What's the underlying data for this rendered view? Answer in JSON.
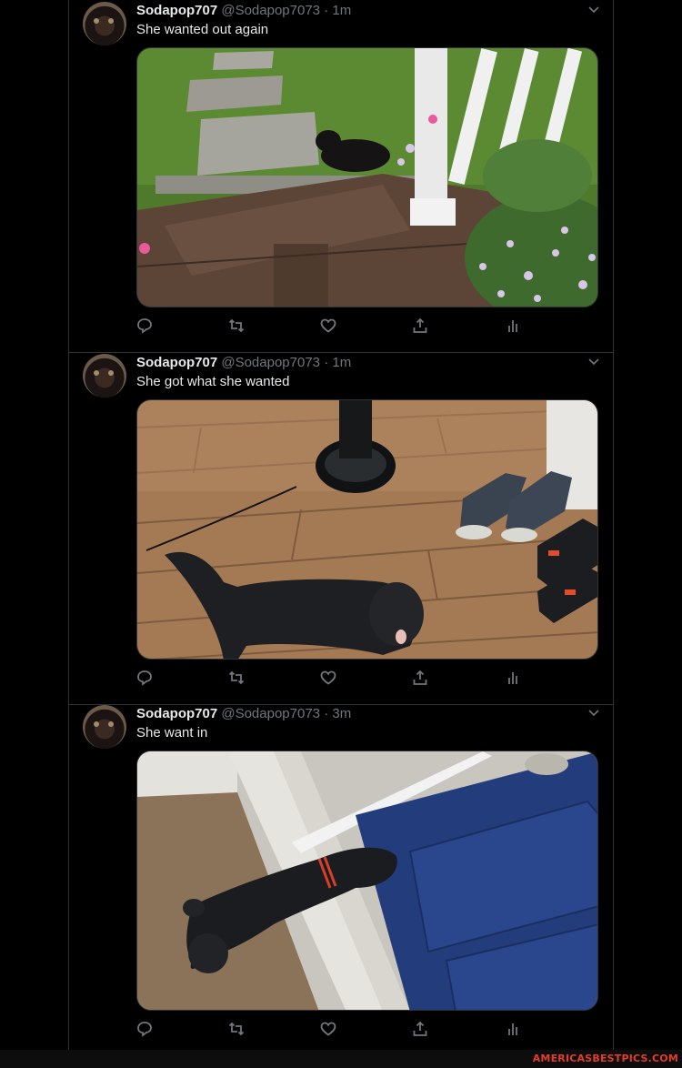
{
  "tweets": [
    {
      "name": "Sodapop707",
      "handle": "@Sodapop7073",
      "sep": "·",
      "time": "1m",
      "text": "She wanted out again",
      "media": "dog-on-deck-photo"
    },
    {
      "name": "Sodapop707",
      "handle": "@Sodapop7073",
      "sep": "·",
      "time": "1m",
      "text": "She got what she wanted",
      "media": "dog-on-wood-floor-photo"
    },
    {
      "name": "Sodapop707",
      "handle": "@Sodapop7073",
      "sep": "·",
      "time": "3m",
      "text": "She want in",
      "media": "dog-at-blue-door-photo"
    }
  ],
  "icons": {
    "reply": "reply-icon",
    "retweet": "retweet-icon",
    "like": "heart-icon",
    "share": "share-icon",
    "analytics": "analytics-icon",
    "more": "chevron-down-icon"
  },
  "colors": {
    "background": "#000000",
    "text": "#e7e9ea",
    "muted": "#71767b",
    "border": "#2f3336",
    "watermark": "#e33d2a"
  },
  "watermark": {
    "text": "AMERICASBESTPICS.COM"
  }
}
